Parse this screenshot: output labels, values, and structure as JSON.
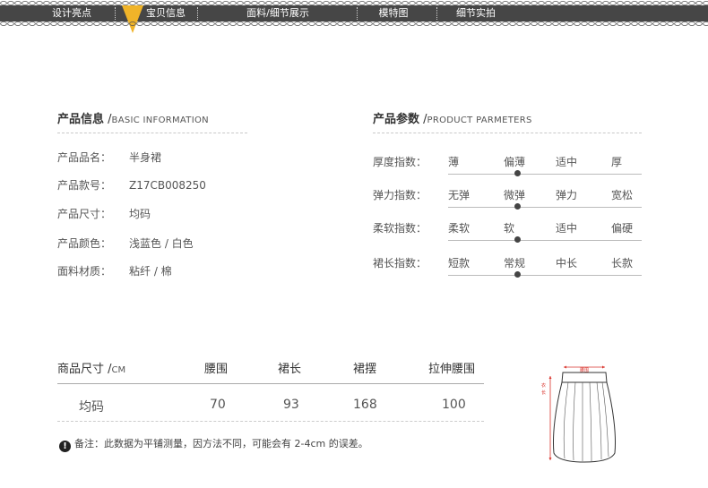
{
  "nav": {
    "items": [
      {
        "label": "设计亮点"
      },
      {
        "label": "宝贝信息"
      },
      {
        "label": "面料/细节展示"
      },
      {
        "label": "模特图"
      },
      {
        "label": "细节实拍"
      }
    ],
    "active_index": 1,
    "bar_color": "#464646",
    "marker_color": "#f0b429"
  },
  "product_info": {
    "title": "产品信息",
    "subtitle": "BASIC INFORMATION",
    "rows": [
      {
        "label": "产品品名：",
        "value": "半身裙"
      },
      {
        "label": "产品款号：",
        "value": "Z17CB008250"
      },
      {
        "label": "产品尺寸：",
        "value": "均码"
      },
      {
        "label": "产品颜色：",
        "value": "浅蓝色 / 白色"
      },
      {
        "label": "面料材质：",
        "value": "粘纤 / 棉"
      }
    ]
  },
  "product_params": {
    "title": "产品参数",
    "subtitle": "PRODUCT PARMETERS",
    "rows": [
      {
        "label": "厚度指数：",
        "options": [
          "薄",
          "偏薄",
          "适中",
          "厚"
        ],
        "selected": 1
      },
      {
        "label": "弹力指数：",
        "options": [
          "无弹",
          "微弹",
          "弹力",
          "宽松"
        ],
        "selected": 1
      },
      {
        "label": "柔软指数：",
        "options": [
          "柔软",
          "软",
          "适中",
          "偏硬"
        ],
        "selected": 1
      },
      {
        "label": "裙长指数：",
        "options": [
          "短款",
          "常规",
          "中长",
          "长款"
        ],
        "selected": 1
      }
    ]
  },
  "size_table": {
    "header_label": "商品尺寸 /",
    "header_unit": "CM",
    "columns": [
      "腰围",
      "裙长",
      "裙摆",
      "拉伸腰围"
    ],
    "row_label": "均码",
    "values": [
      "70",
      "93",
      "168",
      "100"
    ]
  },
  "note": {
    "icon": "exclamation-icon",
    "text": "备注：此数据为平铺测量，因方法不同，可能会有 2-4cm 的误差。"
  },
  "diagram": {
    "waist_label": "腰围",
    "length_label": "衣长",
    "accent_color": "#d9322b"
  }
}
